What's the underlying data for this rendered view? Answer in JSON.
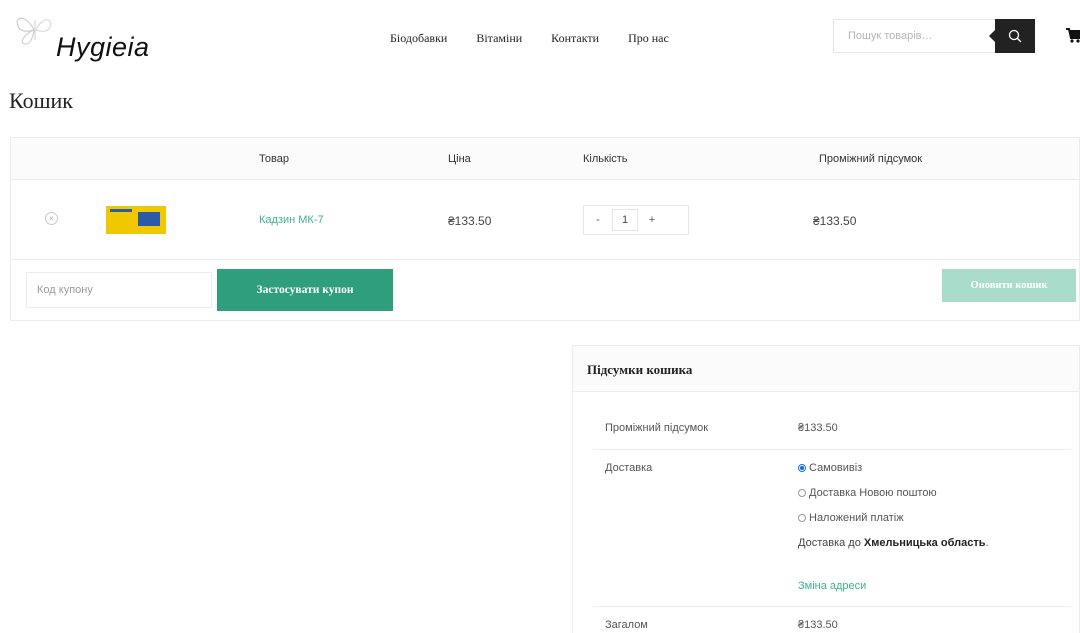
{
  "header": {
    "logo_text": "Hygieia",
    "nav": [
      "Біодобавки",
      "Вітаміни",
      "Контакти",
      "Про нас"
    ],
    "search_placeholder": "Пошук товарів…"
  },
  "page_title": "Кошик",
  "cart": {
    "columns": [
      "",
      "",
      "Товар",
      "Ціна",
      "Кількість",
      "Проміжний підсумок"
    ],
    "items": [
      {
        "name": "Кадзин МК-7",
        "price": "₴133.50",
        "quantity": "1",
        "subtotal": "₴133.50"
      }
    ],
    "qty_minus": "-",
    "qty_plus": "+",
    "remove_symbol": "×",
    "coupon_placeholder": "Код купону",
    "apply_coupon": "Застосувати купон",
    "update_cart": "Оновити кошик"
  },
  "totals": {
    "title": "Підсумки кошика",
    "subtotal_label": "Проміжний підсумок",
    "subtotal_value": "₴133.50",
    "shipping_label": "Доставка",
    "shipping_options": [
      {
        "label": "Самовивіз",
        "checked": true
      },
      {
        "label": "Доставка Новою поштою",
        "checked": false
      },
      {
        "label": "Наложений платіж",
        "checked": false
      }
    ],
    "shipping_dest_prefix": "Доставка до",
    "shipping_dest_region": "Хмельницька область",
    "shipping_dest_suffix": ".",
    "change_address": "Зміна адреси",
    "total_label": "Загалом",
    "total_value": "₴133.50"
  },
  "colors": {
    "accent": "#2e9e7c",
    "accent_light": "#a9dccb",
    "link": "#3fb08b",
    "dark": "#222222"
  }
}
